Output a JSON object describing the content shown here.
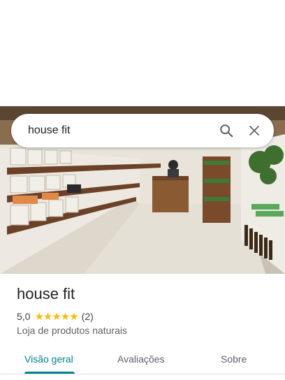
{
  "search": {
    "query": "house fit"
  },
  "place": {
    "name": "house fit",
    "rating": "5,0",
    "stars": "★★★★★",
    "review_count": "(2)",
    "category": "Loja de produtos naturais"
  },
  "tabs": [
    {
      "label": "Visão geral",
      "active": true
    },
    {
      "label": "Avaliações",
      "active": false
    },
    {
      "label": "Sobre",
      "active": false
    }
  ],
  "colors": {
    "accent": "#00838f",
    "star": "#fbbc04"
  },
  "icons": [
    "search-icon",
    "close-icon"
  ]
}
